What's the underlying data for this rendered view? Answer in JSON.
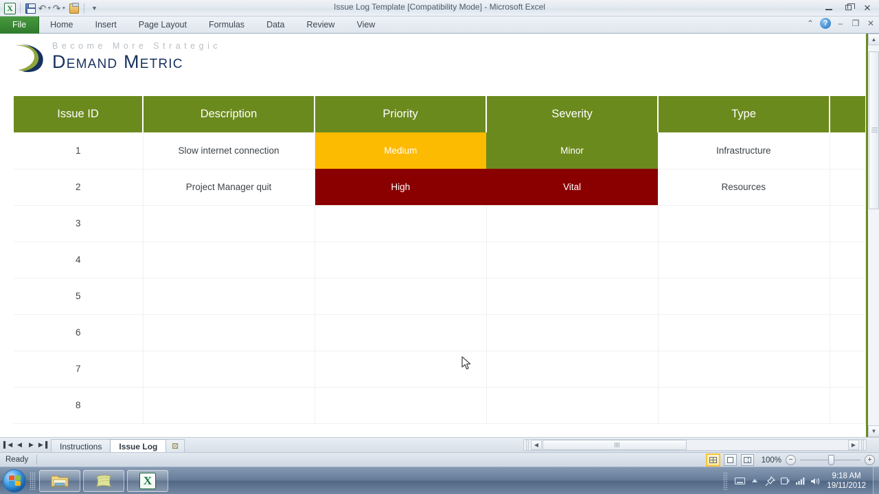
{
  "window": {
    "title": "Issue Log Template  [Compatibility Mode]  -  Microsoft Excel",
    "minimize_label": "Minimize",
    "restore_label": "Restore Down",
    "close_label": "Close"
  },
  "quick_access": {
    "app_icon": "excel-icon",
    "items": [
      {
        "name": "save-icon",
        "label": "Save"
      },
      {
        "name": "undo-icon",
        "label": "Undo"
      },
      {
        "name": "redo-icon",
        "label": "Redo"
      },
      {
        "name": "quick-print-icon",
        "label": "Quick Print"
      },
      {
        "name": "customize-qat-icon",
        "label": "Customize Quick Access Toolbar"
      }
    ]
  },
  "ribbon": {
    "tabs": [
      {
        "label": "File"
      },
      {
        "label": "Home"
      },
      {
        "label": "Insert"
      },
      {
        "label": "Page Layout"
      },
      {
        "label": "Formulas"
      },
      {
        "label": "Data"
      },
      {
        "label": "Review"
      },
      {
        "label": "View"
      }
    ],
    "right_icons": [
      {
        "name": "minimize-ribbon-icon",
        "glyph": "⌃"
      },
      {
        "name": "help-icon",
        "glyph": "?"
      },
      {
        "name": "workbook-minimize-icon",
        "glyph": "–"
      },
      {
        "name": "workbook-restore-icon",
        "glyph": "❐"
      },
      {
        "name": "workbook-close-icon",
        "glyph": "✕"
      }
    ]
  },
  "logo": {
    "tagline": "Become More Strategic",
    "brand": "Demand Metric"
  },
  "table": {
    "columns": [
      "Issue ID",
      "Description",
      "Priority",
      "Severity",
      "Type",
      ""
    ],
    "rows": [
      {
        "issue_id": "1",
        "description": "Slow internet connection",
        "priority": "Medium",
        "priority_fill": "amber",
        "severity": "Minor",
        "severity_fill": "green",
        "type": "Infrastructure",
        "extra": ""
      },
      {
        "issue_id": "2",
        "description": "Project Manager quit",
        "priority": "High",
        "priority_fill": "darkred",
        "severity": "Vital",
        "severity_fill": "darkred",
        "type": "Resources",
        "extra": ""
      },
      {
        "issue_id": "3",
        "description": "",
        "priority": "",
        "priority_fill": "none",
        "severity": "",
        "severity_fill": "none",
        "type": "",
        "extra": ""
      },
      {
        "issue_id": "4",
        "description": "",
        "priority": "",
        "priority_fill": "none",
        "severity": "",
        "severity_fill": "none",
        "type": "",
        "extra": ""
      },
      {
        "issue_id": "5",
        "description": "",
        "priority": "",
        "priority_fill": "none",
        "severity": "",
        "severity_fill": "none",
        "type": "",
        "extra": ""
      },
      {
        "issue_id": "6",
        "description": "",
        "priority": "",
        "priority_fill": "none",
        "severity": "",
        "severity_fill": "none",
        "type": "",
        "extra": ""
      },
      {
        "issue_id": "7",
        "description": "",
        "priority": "",
        "priority_fill": "none",
        "severity": "",
        "severity_fill": "none",
        "type": "",
        "extra": ""
      },
      {
        "issue_id": "8",
        "description": "",
        "priority": "",
        "priority_fill": "none",
        "severity": "",
        "severity_fill": "none",
        "type": "",
        "extra": ""
      }
    ]
  },
  "colors": {
    "header_green": "#6b8a1e",
    "amber": "#fcba00",
    "dark_red": "#8a0000",
    "brand_navy": "#17315e",
    "brand_olive": "#8ea63a"
  },
  "sheet_tabs": {
    "nav": [
      {
        "name": "first-sheet-button",
        "glyph": "▌◀"
      },
      {
        "name": "previous-sheet-button",
        "glyph": "◀"
      },
      {
        "name": "next-sheet-button",
        "glyph": "▶"
      },
      {
        "name": "last-sheet-button",
        "glyph": "▶▐"
      }
    ],
    "tabs": [
      {
        "label": "Instructions",
        "active": false
      },
      {
        "label": "Issue Log",
        "active": true
      }
    ],
    "insert_sheet_label": "⚄"
  },
  "status_bar": {
    "message": "Ready",
    "views": [
      {
        "name": "normal-view-button",
        "label": "Normal",
        "selected": true
      },
      {
        "name": "page-layout-view-button",
        "label": "Page Layout",
        "selected": false
      },
      {
        "name": "page-break-preview-button",
        "label": "Page Break Preview",
        "selected": false
      }
    ],
    "zoom": "100%",
    "zoom_out_label": "−",
    "zoom_in_label": "+"
  },
  "taskbar": {
    "start_label": "Start",
    "buttons": [
      {
        "name": "taskbar-windows-explorer",
        "label": "Windows Explorer"
      },
      {
        "name": "taskbar-notes-app",
        "label": "Notes"
      },
      {
        "name": "taskbar-excel",
        "label": "Microsoft Excel"
      }
    ],
    "tray_icons": [
      {
        "name": "keyboard-icon",
        "glyph": "⌨"
      },
      {
        "name": "show-hidden-icons-icon",
        "glyph": "▲"
      },
      {
        "name": "pin-icon",
        "glyph": "✐"
      },
      {
        "name": "power-plug-icon",
        "glyph": "⚡"
      },
      {
        "name": "network-signal-icon",
        "glyph": "▪"
      },
      {
        "name": "volume-icon",
        "glyph": "🔊"
      }
    ],
    "clock_time": "9:18 AM",
    "clock_date": "19/11/2012"
  }
}
